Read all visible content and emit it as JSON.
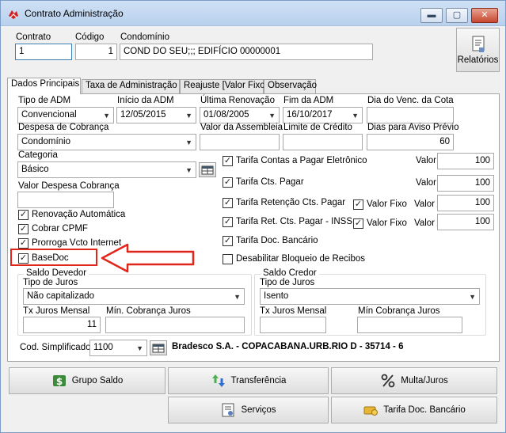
{
  "window": {
    "title": "Contrato Administração",
    "min_label": "▬",
    "max_label": "▢",
    "close_label": "✕"
  },
  "header": {
    "contrato_label": "Contrato",
    "contrato_value": "1",
    "codigo_label": "Código",
    "codigo_value": "1",
    "condominio_label": "Condomínio",
    "condominio_value": "COND DO SEU;;; EDIFÍCIO 00000001",
    "relatorios_label": "Relatórios"
  },
  "tabs": [
    {
      "label": "Dados Principais",
      "active": true
    },
    {
      "label": "Taxa de Administração"
    },
    {
      "label": "Reajuste [Valor Fixo]"
    },
    {
      "label": "Observação"
    }
  ],
  "fields": {
    "tipo_adm_label": "Tipo de ADM",
    "tipo_adm_value": "Convencional",
    "inicio_adm_label": "Início da ADM",
    "inicio_adm_value": "12/05/2015",
    "ultima_renov_label": "Última Renovação",
    "ultima_renov_value": "01/08/2005",
    "fim_adm_label": "Fim da ADM",
    "fim_adm_value": "16/10/2017",
    "dia_venc_label": "Dia do Venc. da Cota",
    "dia_venc_value": "",
    "despesa_cobranca_label": "Despesa de Cobrança",
    "despesa_cobranca_value": "Condomínio",
    "valor_assembleia_label": "Valor da Assembleia",
    "valor_assembleia_value": "",
    "limite_credito_label": "Limite de Crédito",
    "limite_credito_value": "",
    "dias_aviso_label": "Dias para Aviso Prévio",
    "dias_aviso_value": "60",
    "categoria_label": "Categoria",
    "categoria_value": "Básico",
    "valor_despesa_label": "Valor Despesa Cobrança",
    "valor_despesa_value": ""
  },
  "left_checks": [
    {
      "label": "Renovação Automática",
      "checked": true
    },
    {
      "label": "Cobrar CPMF",
      "checked": true
    },
    {
      "label": "Prorroga Vcto Internet",
      "checked": true
    },
    {
      "label": "BaseDoc",
      "checked": true
    }
  ],
  "tarifas": {
    "valor_label": "Valor",
    "valor_fixo_label": "Valor Fixo",
    "items": [
      {
        "label": "Tarifa Contas a Pagar Eletrônico",
        "checked": true,
        "value": "100"
      },
      {
        "label": "Tarifa Cts. Pagar",
        "checked": true,
        "value": "100"
      },
      {
        "label": "Tarifa Retenção Cts. Pagar",
        "checked": true,
        "value": "100"
      },
      {
        "label": "Tarifa Ret. Cts. Pagar - INSS",
        "checked": true,
        "value": "100"
      },
      {
        "label": "Tarifa Doc. Bancário",
        "checked": true
      },
      {
        "label": "Desabilitar Bloqueio de Recibos",
        "checked": false
      }
    ]
  },
  "saldo_devedor": {
    "title": "Saldo Devedor",
    "tipo_juros_label": "Tipo de Juros",
    "tipo_juros_value": "Não capitalizado",
    "tx_juros_label": "Tx Juros Mensal",
    "tx_juros_value": "11",
    "min_cobranca_label": "Mín. Cobrança Juros",
    "min_cobranca_value": ""
  },
  "saldo_credor": {
    "title": "Saldo Credor",
    "tipo_juros_label": "Tipo de Juros",
    "tipo_juros_value": "Isento",
    "tx_juros_label": "Tx Juros Mensal",
    "tx_juros_value": "",
    "min_cobranca_label": "Mín Cobrança Juros",
    "min_cobranca_value": ""
  },
  "cod_simplificado": {
    "label": "Cod. Simplificado",
    "value": "1100",
    "bank_text": "Bradesco S.A. - COPACABANA.URB.RIO D - 35714 - 6"
  },
  "buttons": {
    "grupo_saldo": "Grupo Saldo",
    "transferencia": "Transferência",
    "multa_juros": "Multa/Juros",
    "servicos": "Serviços",
    "tarifa_doc": "Tarifa Doc. Bancário"
  },
  "colors": {
    "annotation_red": "#e0261b",
    "titlebar": "#c4d8f1",
    "focus_border": "#3c7fb1"
  }
}
